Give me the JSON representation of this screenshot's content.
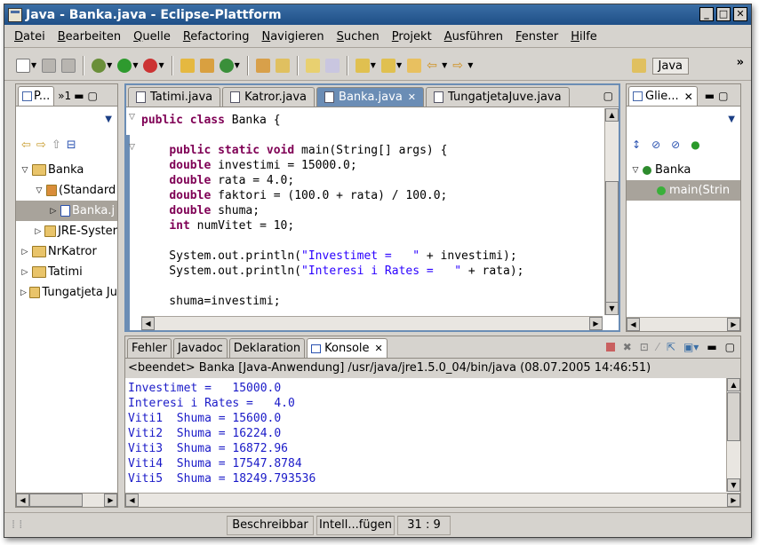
{
  "window": {
    "title": "Java - Banka.java - Eclipse-Plattform",
    "controls": [
      "_",
      "□",
      "✕"
    ]
  },
  "menu": [
    "Datei",
    "Bearbeiten",
    "Quelle",
    "Refactoring",
    "Navigieren",
    "Suchen",
    "Projekt",
    "Ausführen",
    "Fenster",
    "Hilfe"
  ],
  "perspective": {
    "label": "Java",
    "more": "»"
  },
  "package_explorer": {
    "tab_label": "P...",
    "overflow": "»1",
    "tree": [
      {
        "label": "Banka",
        "indent": 0,
        "twisty": "▽"
      },
      {
        "label": "(Standard",
        "indent": 1,
        "twisty": "▽"
      },
      {
        "label": "Banka.j",
        "indent": 2,
        "twisty": "▷",
        "selected": true
      },
      {
        "label": "JRE-Syster",
        "indent": 1,
        "twisty": "▷"
      },
      {
        "label": "NrKatror",
        "indent": 0,
        "twisty": "▷"
      },
      {
        "label": "Tatimi",
        "indent": 0,
        "twisty": "▷"
      },
      {
        "label": "Tungatjeta Ju",
        "indent": 0,
        "twisty": "▷"
      }
    ]
  },
  "editor": {
    "tabs": [
      "Tatimi.java",
      "Katror.java",
      "Banka.java",
      "TungatjetaJuve.java"
    ],
    "active_tab": 2,
    "lines": [
      [
        {
          "t": "public class",
          "c": "kw"
        },
        {
          "t": " Banka {"
        }
      ],
      [
        {
          "t": ""
        }
      ],
      [
        {
          "t": "    "
        },
        {
          "t": "public static void",
          "c": "kw"
        },
        {
          "t": " main(String[] args) {"
        }
      ],
      [
        {
          "t": "    "
        },
        {
          "t": "double",
          "c": "kw"
        },
        {
          "t": " investimi = 15000.0;"
        }
      ],
      [
        {
          "t": "    "
        },
        {
          "t": "double",
          "c": "kw"
        },
        {
          "t": " rata = 4.0;"
        }
      ],
      [
        {
          "t": "    "
        },
        {
          "t": "double",
          "c": "kw"
        },
        {
          "t": " faktori = (100.0 + rata) / 100.0;"
        }
      ],
      [
        {
          "t": "    "
        },
        {
          "t": "double",
          "c": "kw"
        },
        {
          "t": " shuma;"
        }
      ],
      [
        {
          "t": "    "
        },
        {
          "t": "int",
          "c": "kw"
        },
        {
          "t": " numVitet = 10;"
        }
      ],
      [
        {
          "t": ""
        }
      ],
      [
        {
          "t": "    System.out.println("
        },
        {
          "t": "\"Investimet =   \"",
          "c": "str"
        },
        {
          "t": " + investimi);"
        }
      ],
      [
        {
          "t": "    System.out.println("
        },
        {
          "t": "\"Interesi i Rates =   \"",
          "c": "str"
        },
        {
          "t": " + rata);"
        }
      ],
      [
        {
          "t": ""
        }
      ],
      [
        {
          "t": "    shuma=investimi;"
        }
      ]
    ]
  },
  "outline": {
    "tab_label": "Glie...",
    "tree": [
      {
        "label": "Banka",
        "indent": 0
      },
      {
        "label": "main(Strin",
        "indent": 1,
        "selected": true
      }
    ]
  },
  "bottom": {
    "tabs": [
      "Fehler",
      "Javadoc",
      "Deklaration",
      "Konsole"
    ],
    "active_tab": 3,
    "console_header": "<beendet> Banka [Java-Anwendung] /usr/java/jre1.5.0_04/bin/java (08.07.2005 14:46:51)",
    "output": [
      "Investimet =   15000.0",
      "Interesi i Rates =   4.0",
      "Viti1  Shuma = 15600.0",
      "Viti2  Shuma = 16224.0",
      "Viti3  Shuma = 16872.96",
      "Viti4  Shuma = 17547.8784",
      "Viti5  Shuma = 18249.793536"
    ]
  },
  "status": {
    "mode": "Beschreibbar",
    "insert": "Intell...fügen",
    "position": "31 : 9"
  },
  "colors": {
    "titlebar": "#2a5d96",
    "active_tab": "#6b8db5",
    "keyword": "#7f0055",
    "string": "#2a00ff",
    "console_text": "#1a1ac8"
  }
}
